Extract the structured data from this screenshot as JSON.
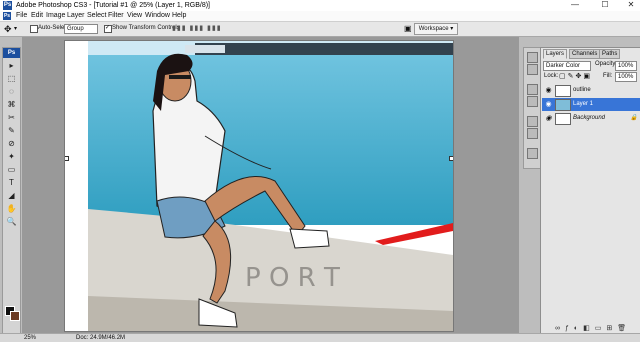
{
  "window": {
    "logo": "Ps",
    "title": "Adobe Photoshop CS3 - [Tutorial #1 @ 25% (Layer 1, RGB/8)]",
    "minimize": "—",
    "maximize": "☐",
    "close": "✕"
  },
  "menu": {
    "logo": "Ps",
    "items": [
      "File",
      "Edit",
      "Image",
      "Layer",
      "Select",
      "Filter",
      "View",
      "Window",
      "Help"
    ]
  },
  "options": {
    "auto_select_label": "Auto-Select:",
    "auto_select_value": "Group",
    "show_transform_label": "Show Transform Controls",
    "workspace_label": "Workspace ▾"
  },
  "tools": [
    "▸",
    "⬚",
    "◌",
    "⌘",
    "✂",
    "✎",
    "⊘",
    "✦",
    "▭",
    "T",
    "◢",
    "✋",
    "🔍"
  ],
  "status": {
    "zoom": "25%",
    "doc": "Doc: 24.9M/46.2M"
  },
  "layers_panel": {
    "tabs": [
      "Layers",
      "Channels",
      "Paths"
    ],
    "blend_mode": "Darker Color",
    "opacity_label": "Opacity:",
    "opacity_value": "100%",
    "lock_label": "Lock:",
    "fill_label": "Fill:",
    "fill_value": "100%",
    "layers": [
      {
        "name": "outline",
        "selected": false
      },
      {
        "name": "Layer 1",
        "selected": true
      },
      {
        "name": "Background",
        "selected": false,
        "locked": true
      }
    ],
    "lock_icon": "🔒"
  },
  "colors": {
    "selected_layer": "#3875d7",
    "sea": "#3ba5c7",
    "sky": "#c9e7f4"
  }
}
